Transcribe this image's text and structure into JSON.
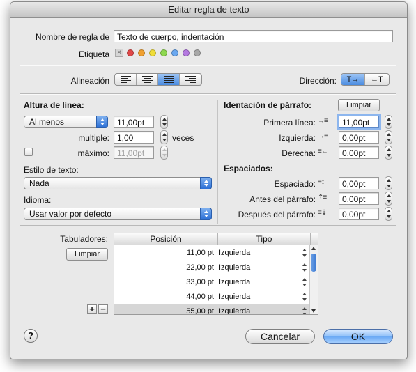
{
  "window": {
    "title": "Editar regla de texto"
  },
  "name_row": {
    "label": "Nombre de regla de",
    "value": "Texto de cuerpo, indentación"
  },
  "tag_row": {
    "label": "Etiqueta",
    "colors": [
      "#e04848",
      "#f0a030",
      "#f0dd38",
      "#8ed850",
      "#6aa8f0",
      "#b479e0",
      "#a8a8a8"
    ]
  },
  "alignment": {
    "label": "Alineación",
    "options": [
      "left",
      "center",
      "justify",
      "right"
    ],
    "selected": "justify"
  },
  "direction": {
    "label": "Dirección:",
    "options": [
      "T→",
      "←T"
    ],
    "selected": "T→"
  },
  "line_height": {
    "title": "Altura de línea:",
    "mode": "Al menos",
    "value": "11,00pt",
    "multiple_label": "multiple:",
    "multiple_value": "1,00",
    "multiple_unit": "veces",
    "max_label": "máximo:",
    "max_value": "11,00pt",
    "max_checked": false
  },
  "text_style": {
    "label": "Estilo de texto:",
    "value": "Nada"
  },
  "language": {
    "label": "Idioma:",
    "value": "Usar valor por defecto"
  },
  "indent": {
    "title": "Identación de párrafo:",
    "clear_label": "Limpiar",
    "first_line_label": "Primera línea:",
    "first_line_value": "11,00pt",
    "left_label": "Izquierda:",
    "left_value": "0,00pt",
    "right_label": "Derecha:",
    "right_value": "0,00pt"
  },
  "spacing": {
    "title": "Espaciados:",
    "spacing_label": "Espaciado:",
    "spacing_value": "0,00pt",
    "before_label": "Antes del párrafo:",
    "before_value": "0,00pt",
    "after_label": "Después del párrafo:",
    "after_value": "0,00pt"
  },
  "tabs": {
    "label": "Tabuladores:",
    "clear_label": "Limpiar",
    "columns": [
      "Posición",
      "Tipo"
    ],
    "rows": [
      {
        "position": "11,00 pt",
        "type": "Izquierda"
      },
      {
        "position": "22,00 pt",
        "type": "Izquierda"
      },
      {
        "position": "33,00 pt",
        "type": "Izquierda"
      },
      {
        "position": "44,00 pt",
        "type": "Izquierda"
      },
      {
        "position": "55,00 pt",
        "type": "Izquierda"
      }
    ],
    "add_label": "+",
    "remove_label": "−"
  },
  "footer": {
    "help_label": "?",
    "cancel_label": "Cancelar",
    "ok_label": "OK"
  }
}
